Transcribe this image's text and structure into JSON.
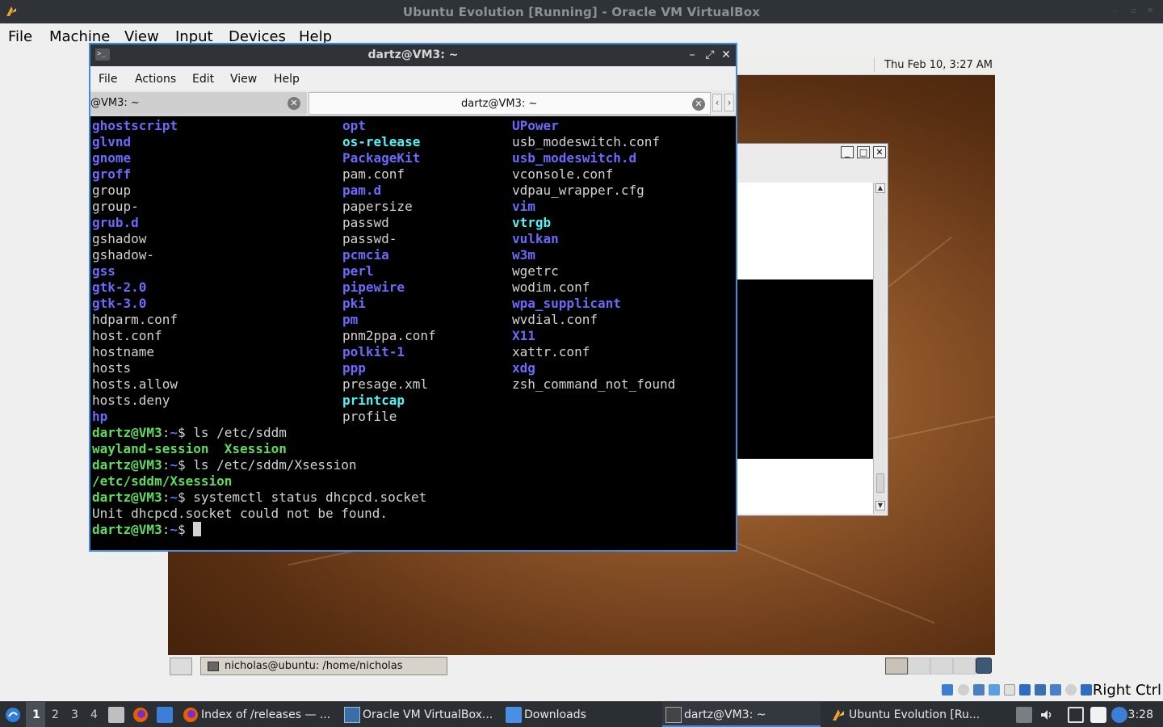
{
  "host_window": {
    "title": "Ubuntu Evolution [Running] - Oracle VM VirtualBox",
    "menu": [
      "File",
      "Machine",
      "View",
      "Input",
      "Devices",
      "Help"
    ]
  },
  "guest": {
    "clock": "Thu Feb 10,  3:27 AM",
    "panel_task": "nicholas@ubuntu: /home/nicholas"
  },
  "status_bar": {
    "host_key": "Right Ctrl"
  },
  "terminal": {
    "title": "dartz@VM3: ~",
    "menu": [
      "File",
      "Actions",
      "Edit",
      "View",
      "Help"
    ],
    "tabs": [
      "@VM3: ~",
      "dartz@VM3: ~"
    ],
    "listing_col1": [
      {
        "t": "ghostscript",
        "k": "dir"
      },
      {
        "t": "glvnd",
        "k": "dir"
      },
      {
        "t": "gnome",
        "k": "dir"
      },
      {
        "t": "groff",
        "k": "dir"
      },
      {
        "t": "group",
        "k": "file"
      },
      {
        "t": "group-",
        "k": "file"
      },
      {
        "t": "grub.d",
        "k": "dir"
      },
      {
        "t": "gshadow",
        "k": "file"
      },
      {
        "t": "gshadow-",
        "k": "file"
      },
      {
        "t": "gss",
        "k": "dir"
      },
      {
        "t": "gtk-2.0",
        "k": "dir"
      },
      {
        "t": "gtk-3.0",
        "k": "dir"
      },
      {
        "t": "hdparm.conf",
        "k": "file"
      },
      {
        "t": "host.conf",
        "k": "file"
      },
      {
        "t": "hostname",
        "k": "file"
      },
      {
        "t": "hosts",
        "k": "file"
      },
      {
        "t": "hosts.allow",
        "k": "file"
      },
      {
        "t": "hosts.deny",
        "k": "file"
      },
      {
        "t": "hp",
        "k": "dir"
      }
    ],
    "listing_col2": [
      {
        "t": "opt",
        "k": "dir"
      },
      {
        "t": "os-release",
        "k": "link"
      },
      {
        "t": "PackageKit",
        "k": "dir"
      },
      {
        "t": "pam.conf",
        "k": "file"
      },
      {
        "t": "pam.d",
        "k": "dir"
      },
      {
        "t": "papersize",
        "k": "file"
      },
      {
        "t": "passwd",
        "k": "file"
      },
      {
        "t": "passwd-",
        "k": "file"
      },
      {
        "t": "pcmcia",
        "k": "dir"
      },
      {
        "t": "perl",
        "k": "dir"
      },
      {
        "t": "pipewire",
        "k": "dir"
      },
      {
        "t": "pki",
        "k": "dir"
      },
      {
        "t": "pm",
        "k": "dir"
      },
      {
        "t": "pnm2ppa.conf",
        "k": "file"
      },
      {
        "t": "polkit-1",
        "k": "dir"
      },
      {
        "t": "ppp",
        "k": "dir"
      },
      {
        "t": "presage.xml",
        "k": "file"
      },
      {
        "t": "printcap",
        "k": "link"
      },
      {
        "t": "profile",
        "k": "file"
      }
    ],
    "listing_col3": [
      {
        "t": "UPower",
        "k": "dir"
      },
      {
        "t": "usb_modeswitch.conf",
        "k": "file"
      },
      {
        "t": "usb_modeswitch.d",
        "k": "dir"
      },
      {
        "t": "vconsole.conf",
        "k": "file"
      },
      {
        "t": "vdpau_wrapper.cfg",
        "k": "file"
      },
      {
        "t": "vim",
        "k": "dir"
      },
      {
        "t": "vtrgb",
        "k": "link"
      },
      {
        "t": "vulkan",
        "k": "dir"
      },
      {
        "t": "w3m",
        "k": "dir"
      },
      {
        "t": "wgetrc",
        "k": "file"
      },
      {
        "t": "wodim.conf",
        "k": "file"
      },
      {
        "t": "wpa_supplicant",
        "k": "dir"
      },
      {
        "t": "wvdial.conf",
        "k": "file"
      },
      {
        "t": "X11",
        "k": "dir"
      },
      {
        "t": "xattr.conf",
        "k": "file"
      },
      {
        "t": "xdg",
        "k": "dir"
      },
      {
        "t": "zsh_command_not_found",
        "k": "file"
      }
    ],
    "prompt_user": "dartz@VM3",
    "prompt_path": "~",
    "prompt_sign": "$",
    "cmd1": " ls /etc/sddm",
    "out1a": "wayland-session",
    "out1b": "Xsession",
    "cmd2": " ls /etc/sddm/Xsession",
    "out2": "/etc/sddm/Xsession",
    "cmd3": " systemctl status dhcpcd.socket",
    "out3": "Unit dhcpcd.socket could not be found."
  },
  "taskbar": {
    "workspaces": [
      "1",
      "2",
      "3",
      "4"
    ],
    "tasks": [
      "Index of /releases — ...",
      "Oracle VM VirtualBox...",
      "Downloads",
      "dartz@VM3: ~",
      "Ubuntu Evolution [Ru..."
    ],
    "clock": "3:28"
  }
}
